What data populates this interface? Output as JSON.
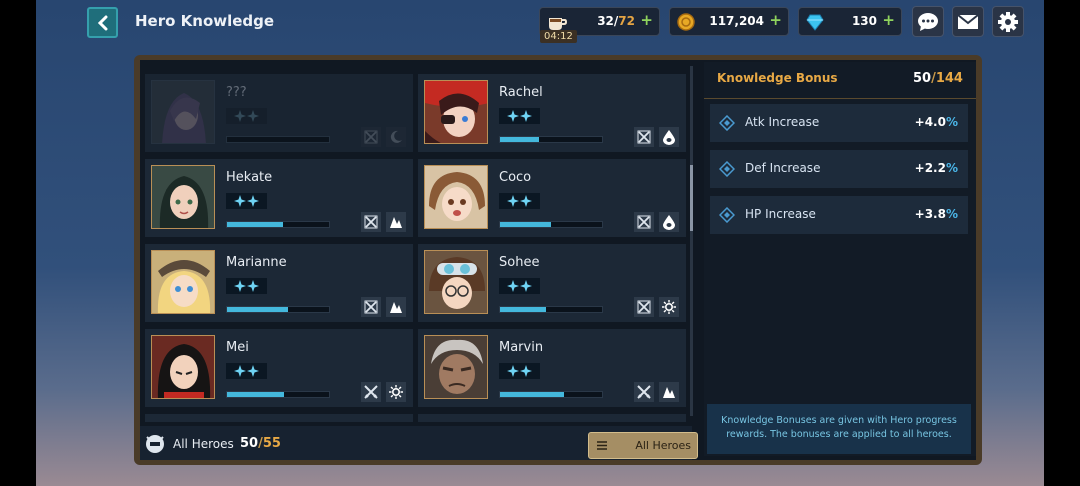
{
  "header": {
    "title": "Hero Knowledge",
    "stamina": {
      "current": "32",
      "max": "72",
      "timer": "04:12"
    },
    "gold": "117,204",
    "gems": "130"
  },
  "heroes": [
    {
      "name": "???",
      "progress": 0,
      "type_icon": "sword-crossed-icon",
      "element_icon": "moon-icon",
      "locked": true
    },
    {
      "name": "Rachel",
      "progress": 0.38,
      "type_icon": "sword-crossed-icon",
      "element_icon": "water-drop-icon"
    },
    {
      "name": "Hekate",
      "progress": 0.55,
      "type_icon": "sword-crossed-icon",
      "element_icon": "earth-icon"
    },
    {
      "name": "Coco",
      "progress": 0.5,
      "type_icon": "sword-crossed-icon",
      "element_icon": "water-drop-icon"
    },
    {
      "name": "Marianne",
      "progress": 0.6,
      "type_icon": "sword-crossed-icon",
      "element_icon": "earth-icon"
    },
    {
      "name": "Sohee",
      "progress": 0.45,
      "type_icon": "sword-crossed-icon",
      "element_icon": "sun-icon"
    },
    {
      "name": "Mei",
      "progress": 0.56,
      "type_icon": "swords-icon",
      "element_icon": "sun-icon"
    },
    {
      "name": "Marvin",
      "progress": 0.63,
      "type_icon": "swords-icon",
      "element_icon": "earth-icon"
    }
  ],
  "footer": {
    "label": "All Heroes",
    "count_current": "50",
    "count_total": "55",
    "filter_label": "All Heroes"
  },
  "bonus": {
    "title": "Knowledge Bonus",
    "current": "50",
    "total": "144",
    "stats": [
      {
        "label": "Atk Increase",
        "value": "+4.0",
        "unit": "%"
      },
      {
        "label": "Def Increase",
        "value": "+2.2",
        "unit": "%"
      },
      {
        "label": "HP Increase",
        "value": "+3.8",
        "unit": "%"
      }
    ],
    "note": "Knowledge Bonuses are given with Hero progress rewards. The bonuses are applied to all heroes."
  },
  "colors": {
    "accent": "#44b8dc",
    "gold": "#e8a945",
    "frame": "#4a3b28"
  }
}
